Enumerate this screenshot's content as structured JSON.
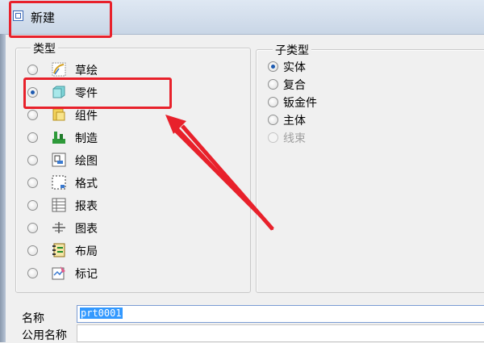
{
  "window": {
    "title": "新建"
  },
  "type_group": {
    "label": "类型",
    "items": [
      {
        "label": "草绘",
        "icon": "sketch-icon",
        "checked": false
      },
      {
        "label": "零件",
        "icon": "part-icon",
        "checked": true
      },
      {
        "label": "组件",
        "icon": "assembly-icon",
        "checked": false
      },
      {
        "label": "制造",
        "icon": "manufacturing-icon",
        "checked": false
      },
      {
        "label": "绘图",
        "icon": "drawing-icon",
        "checked": false
      },
      {
        "label": "格式",
        "icon": "format-icon",
        "checked": false
      },
      {
        "label": "报表",
        "icon": "report-icon",
        "checked": false
      },
      {
        "label": "图表",
        "icon": "diagram-icon",
        "checked": false
      },
      {
        "label": "布局",
        "icon": "layout-icon",
        "checked": false
      },
      {
        "label": "标记",
        "icon": "markup-icon",
        "checked": false
      }
    ]
  },
  "subtype_group": {
    "label": "子类型",
    "items": [
      {
        "label": "实体",
        "checked": true,
        "disabled": false
      },
      {
        "label": "复合",
        "checked": false,
        "disabled": false
      },
      {
        "label": "钣金件",
        "checked": false,
        "disabled": false
      },
      {
        "label": "主体",
        "checked": false,
        "disabled": false
      },
      {
        "label": "线束",
        "checked": false,
        "disabled": true
      }
    ]
  },
  "name_field": {
    "label": "名称",
    "value": "prt0001"
  },
  "common_name_field": {
    "label": "公用名称",
    "value": ""
  },
  "colors": {
    "annotation": "#e8212b",
    "selection": "#3399ff",
    "radio_dot": "#1d5ab0"
  }
}
